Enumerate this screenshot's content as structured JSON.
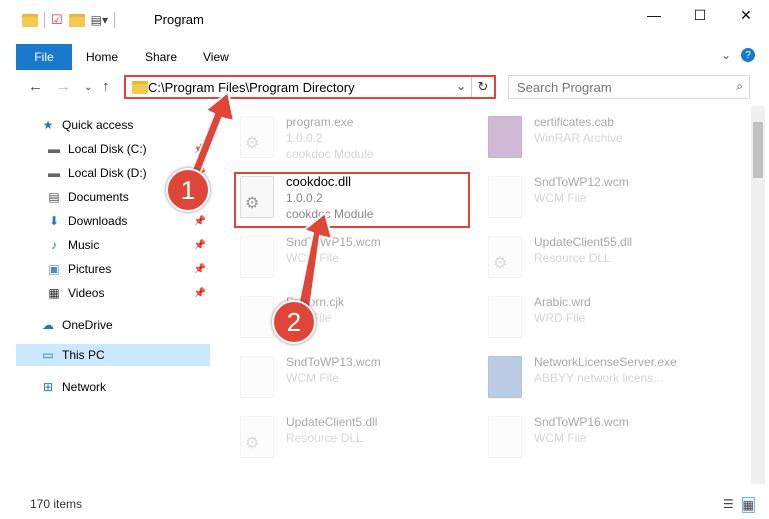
{
  "window": {
    "title": "Program",
    "minimize": "—",
    "maximize": "☐",
    "close": "✕"
  },
  "ribbon": {
    "file": "File",
    "home": "Home",
    "share": "Share",
    "view": "View",
    "expand": "⌄",
    "help": "?"
  },
  "address": {
    "path": "C:\\Program Files\\Program Directory"
  },
  "search": {
    "placeholder": "Search Program"
  },
  "sidebar": {
    "items": [
      {
        "label": "Quick access",
        "icon": "★"
      },
      {
        "label": "Local Disk (C:)",
        "icon": "▬"
      },
      {
        "label": "Local Disk (D:)",
        "icon": "▬"
      },
      {
        "label": "Documents",
        "icon": "▤"
      },
      {
        "label": "Downloads",
        "icon": "⬇"
      },
      {
        "label": "Music",
        "icon": "♪"
      },
      {
        "label": "Pictures",
        "icon": "▣"
      },
      {
        "label": "Videos",
        "icon": "▦"
      },
      {
        "label": "OneDrive",
        "icon": "☁"
      },
      {
        "label": "This PC",
        "icon": "▭"
      },
      {
        "label": "Network",
        "icon": "⊞"
      }
    ]
  },
  "files": [
    {
      "name": "program.exe",
      "line2": "1.0.0.2",
      "line3": "cookdoc Module"
    },
    {
      "name": "certificates.cab",
      "line2": "WinRAR Archive",
      "line3": ""
    },
    {
      "name": "cookdoc.dll",
      "line2": "1.0.0.2",
      "line3": "cookdoc Module"
    },
    {
      "name": "SndToWP12.wcm",
      "line2": "WCM File",
      "line3": ""
    },
    {
      "name": "SndToWP15.wcm",
      "line2": "WCM File",
      "line3": ""
    },
    {
      "name": "UpdateClient55.dll",
      "line2": "Resource DLL",
      "line3": ""
    },
    {
      "name": "EnKorn.cjk",
      "line2": "CJK File",
      "line3": ""
    },
    {
      "name": "Arabic.wrd",
      "line2": "WRD File",
      "line3": ""
    },
    {
      "name": "SndToWP13.wcm",
      "line2": "WCM File",
      "line3": ""
    },
    {
      "name": "NetworkLicenseServer.exe",
      "line2": "ABBYY network licens...",
      "line3": ""
    },
    {
      "name": "UpdateClient5.dll",
      "line2": "Resource DLL",
      "line3": ""
    },
    {
      "name": "SndToWP16.wcm",
      "line2": "WCM File",
      "line3": ""
    }
  ],
  "status": {
    "count": "170 items"
  },
  "callouts": {
    "one": "1",
    "two": "2"
  }
}
